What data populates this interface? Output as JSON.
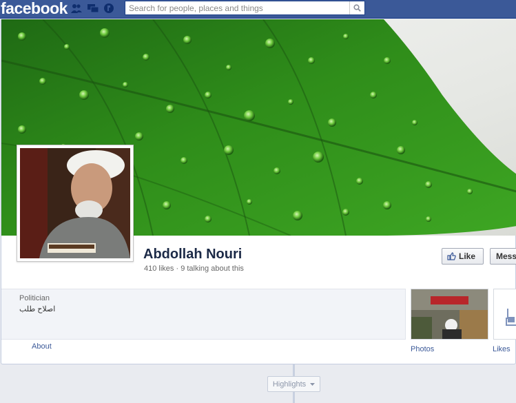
{
  "topbar": {
    "logo": "facebook",
    "search_placeholder": "Search for people, places and things",
    "icons": [
      "friend-requests-icon",
      "messages-icon",
      "notifications-icon",
      "search-icon"
    ]
  },
  "colors": {
    "brand_blue": "#3b5998",
    "name_color": "#1c2a47",
    "link_color": "#3b5998"
  },
  "profile": {
    "name": "Abdollah Nouri",
    "stats": "410 likes · 9 talking about this",
    "category": "Politician",
    "about": "اصلاح طلب",
    "about_link": "About"
  },
  "actions": {
    "like": "Like",
    "message": "Message"
  },
  "apps": {
    "photos": "Photos",
    "likes": "Likes"
  },
  "timeline": {
    "highlights": "Highlights"
  }
}
